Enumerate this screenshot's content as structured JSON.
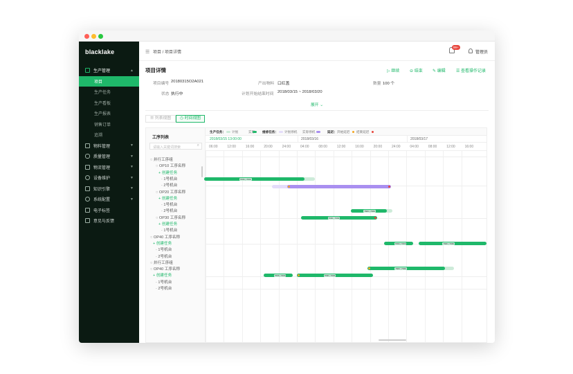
{
  "app": {
    "logo": "blacklake"
  },
  "sidebar": {
    "items": [
      {
        "label": "生产管理",
        "expanded": true
      },
      {
        "label": "物料管理"
      },
      {
        "label": "质量管理"
      },
      {
        "label": "物流管理"
      },
      {
        "label": "设备维护"
      },
      {
        "label": "知识引擎"
      },
      {
        "label": "系统配置"
      },
      {
        "label": "电子标签"
      },
      {
        "label": "意见与反馈"
      }
    ],
    "sub_items": [
      "项目",
      "生产任务",
      "生产看板",
      "生产报表",
      "销售订单",
      "追溯"
    ]
  },
  "header": {
    "breadcrumb": "项目 / 项目详情",
    "badge": "99+",
    "user": "管理员"
  },
  "detail": {
    "title": "项目详情",
    "actions": [
      "继续",
      "结束",
      "编辑",
      "查看操作记录"
    ],
    "fields": {
      "code_label": "项目编号",
      "code_value": "20180315O2A021",
      "product_label": "产出物料",
      "product_value": "口红盖",
      "qty_label": "数量",
      "qty_value": "100 个",
      "status_label": "状态",
      "status_value": "执行中",
      "plan_label": "计划开始结束时间",
      "plan_value": "2018/03/15 ~ 2018/03/20"
    },
    "expand": "展开"
  },
  "view_tabs": [
    "列表视图",
    "时间视图"
  ],
  "legend": {
    "prod_label": "生产任务：",
    "prod_plan": "计划",
    "prod_actual": "实际",
    "maint_label": "维修任务：",
    "maint_plan": "计划停机",
    "maint_actual": "实际停机",
    "delay_label": "延迟：",
    "delay_start": "开始延迟",
    "delay_end": "结束延迟",
    "colors": {
      "green": "#1fb86a",
      "light_green": "#cdebd9",
      "purple": "#a98ff0",
      "light_purple": "#e4dcfa",
      "orange": "#f5a623",
      "red": "#e8453c"
    }
  },
  "timeline": {
    "days": [
      "2018/03/15 13:00:00",
      "2018/03/16",
      "2018/03/17"
    ],
    "hours": [
      "06:00",
      "12:00",
      "16:00",
      "20:00",
      "24:00",
      "04:00",
      "08:00",
      "12:00",
      "16:00",
      "20:00",
      "24:00",
      "04:00",
      "08:00",
      "12:00",
      "16:00"
    ]
  },
  "process_list": {
    "header": "工序列表",
    "search_placeholder": "请输入关键词搜索",
    "rows": [
      {
        "type": "group",
        "label": "并行工序组"
      },
      {
        "type": "op",
        "label": "OP10 工序名称"
      },
      {
        "type": "create",
        "label": "创建任务"
      },
      {
        "type": "machine",
        "label": "1号机台"
      },
      {
        "type": "machine",
        "label": "2号机台"
      },
      {
        "type": "op",
        "label": "OP20 工序名称"
      },
      {
        "type": "create",
        "label": "创建任务"
      },
      {
        "type": "machine",
        "label": "1号机台"
      },
      {
        "type": "machine",
        "label": "2号机台"
      },
      {
        "type": "op",
        "label": "OP30 工序名称"
      },
      {
        "type": "create",
        "label": "创建任务"
      },
      {
        "type": "machine",
        "label": "1号机台"
      },
      {
        "type": "op",
        "label": "OP40 工序名称"
      },
      {
        "type": "create",
        "label": "创建任务"
      },
      {
        "type": "machine",
        "label": "1号机台"
      },
      {
        "type": "machine",
        "label": "2号机台"
      },
      {
        "type": "group",
        "label": "并行工序组"
      },
      {
        "type": "op",
        "label": "OP40 工序名称"
      },
      {
        "type": "create",
        "label": "创建任务"
      },
      {
        "type": "machine",
        "label": "1号机台"
      },
      {
        "type": "machine",
        "label": "2号机台"
      }
    ]
  },
  "bar_chip": {
    "a": "7666",
    "b": "7666"
  }
}
